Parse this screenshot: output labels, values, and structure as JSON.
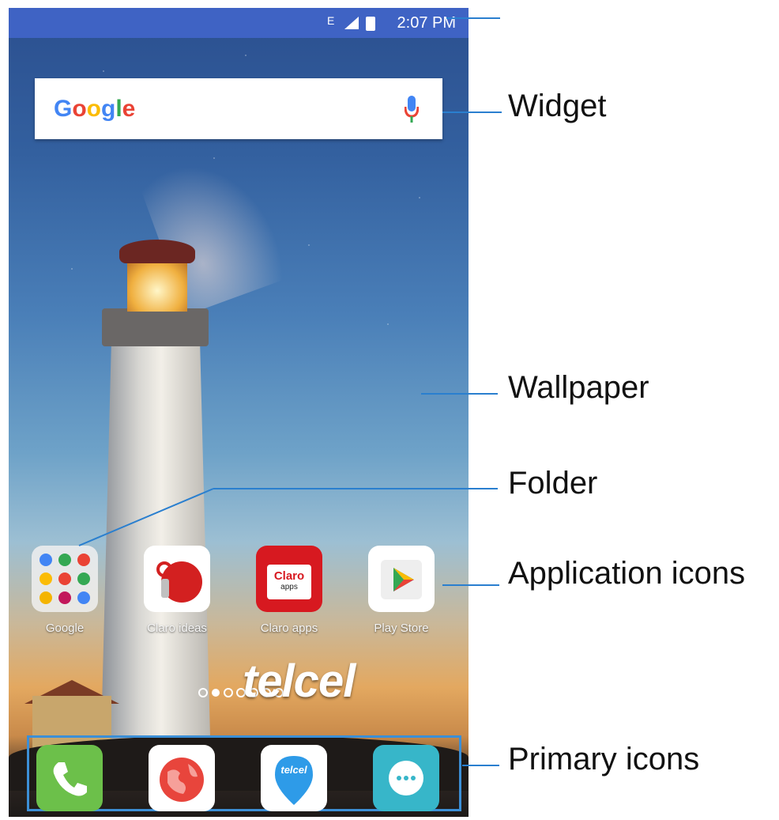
{
  "status_bar": {
    "time": "2:07 PM",
    "sim": "E"
  },
  "search_widget": {
    "logo_text": "Google"
  },
  "apps": [
    {
      "label": "Google",
      "icon": "folder-icon"
    },
    {
      "label": "Claro ideas",
      "icon": "claro-ideas-icon"
    },
    {
      "label": "Claro apps",
      "icon": "claro-apps-icon",
      "tile_text": "Claro",
      "tile_subtext": "apps"
    },
    {
      "label": "Play Store",
      "icon": "play-store-icon"
    }
  ],
  "carrier_logo": "telcel",
  "dock": [
    {
      "icon": "phone-icon"
    },
    {
      "icon": "browser-icon"
    },
    {
      "icon": "telcel-icon",
      "tile_text": "telcel"
    },
    {
      "icon": "messages-icon"
    }
  ],
  "annotations": {
    "widget": "Widget",
    "wallpaper": "Wallpaper",
    "folder": "Folder",
    "application_icons": "Application icons",
    "primary_icons": "Primary icons"
  },
  "colors": {
    "status_bar": "#3f63c4",
    "annotation_line": "#2a7fcf"
  }
}
